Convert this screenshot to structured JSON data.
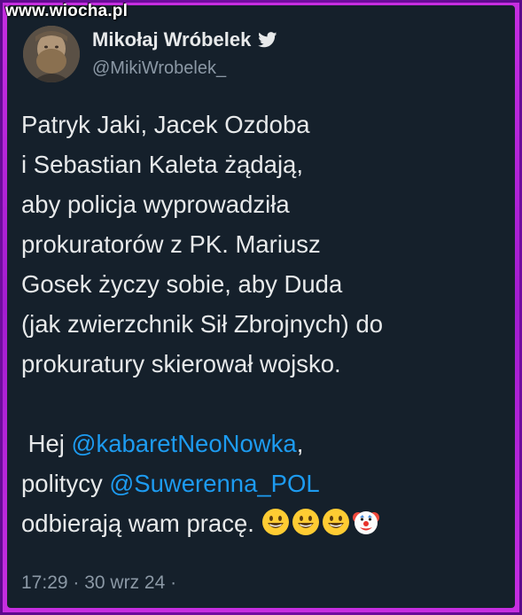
{
  "watermark": "www.wiocha.pl",
  "author": {
    "display_name": "Mikołaj Wróbelek",
    "handle": "@MikiWrobelek_"
  },
  "tweet": {
    "lines": [
      "Patryk Jaki, Jacek Ozdoba",
      "i Sebastian Kaleta żądają,",
      "aby policja wyprowadziła",
      "prokuratorów z PK. Mariusz",
      "Gosek życzy sobie, aby Duda",
      "(jak zwierzchnik Sił Zbrojnych) do",
      "prokuratury skierował wojsko."
    ],
    "second_para": {
      "line1_prefix": " Hej ",
      "mention1": "@kabaretNeoNowka",
      "line1_suffix": ",",
      "line2_prefix": "politycy ",
      "mention2": "@Suwerenna_POL",
      "line3": "odbierają wam pracę. "
    },
    "emojis": [
      "grinning-face-emoji",
      "grinning-face-emoji",
      "grinning-face-emoji",
      "clown-face-emoji"
    ]
  },
  "timestamp": "17:29 · 30 wrz 24 ·",
  "colors": {
    "background": "#15202b",
    "text": "#e7e9ea",
    "secondary": "#8b98a5",
    "link": "#1d9bf0",
    "frame": "#b020d0"
  }
}
